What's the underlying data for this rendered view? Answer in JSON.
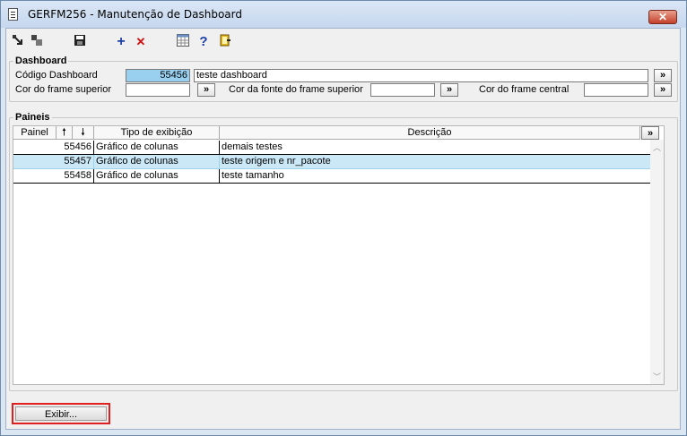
{
  "window": {
    "title": "GERFM256 - Manutenção de Dashboard",
    "close_label": "✕"
  },
  "toolbar": {
    "icons": [
      "navigate-first-icon",
      "navigate-icon",
      "save-icon",
      "add-icon",
      "delete-icon",
      "grid-icon",
      "help-icon",
      "exit-icon"
    ],
    "add_glyph": "+",
    "delete_glyph": "✕",
    "help_glyph": "?"
  },
  "dashboard": {
    "legend": "Dashboard",
    "codigo_label": "Código Dashboard",
    "codigo_value": "55456",
    "descricao_value": "teste dashboard",
    "cor_frame_superior_label": "Cor do frame superior",
    "cor_fonte_label": "Cor da fonte do frame superior",
    "cor_frame_central_label": "Cor do frame central",
    "lookup_label": "»"
  },
  "paineis": {
    "legend": "Paineis",
    "columns": {
      "painel": "Painel",
      "up": "🠕",
      "down": "🠗",
      "tipo": "Tipo de exibição",
      "descricao": "Descrição",
      "more": "»"
    },
    "rows": [
      {
        "painel": "55456",
        "tipo": "Gráfico de colunas",
        "descricao": "demais testes"
      },
      {
        "painel": "55457",
        "tipo": "Gráfico de colunas",
        "descricao": "teste origem e nr_pacote"
      },
      {
        "painel": "55458",
        "tipo": "Gráfico de colunas",
        "descricao": "teste tamanho"
      }
    ],
    "selected_row": 1
  },
  "footer": {
    "exibir_label": "Exibir..."
  },
  "colors": {
    "selection": "#99d0ef",
    "row_highlight": "#cbe8f6",
    "focus_outline": "#e02020"
  }
}
